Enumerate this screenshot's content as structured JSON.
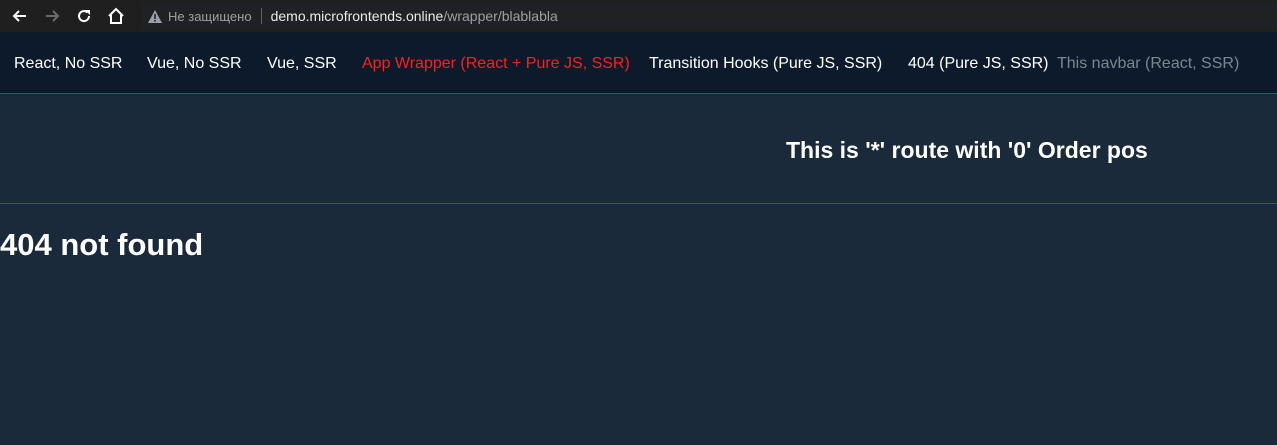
{
  "browser": {
    "security_label": "Не защищено",
    "url_host": "demo.microfrontends.online",
    "url_path": "/wrapper/blablabla",
    "icons": [
      "back-arrow-icon",
      "forward-arrow-icon",
      "reload-icon",
      "home-icon",
      "warning-triangle-icon"
    ]
  },
  "navbar": {
    "items": [
      {
        "label": "React, No SSR"
      },
      {
        "label": "Vue, No SSR"
      },
      {
        "label": "Vue, SSR"
      },
      {
        "label": "App Wrapper (React + Pure JS, SSR)",
        "state": "active"
      },
      {
        "label": "Transition Hooks (Pure JS, SSR)"
      },
      {
        "label": "404 (Pure JS, SSR)"
      },
      {
        "label": "This navbar (React, SSR)",
        "state": "muted"
      }
    ],
    "active_color": "#ff1f1f",
    "divider_color": "#a5282d"
  },
  "main": {
    "route_title": "This is '*' route with '0' Order pos",
    "not_found_text": "404 not found"
  }
}
